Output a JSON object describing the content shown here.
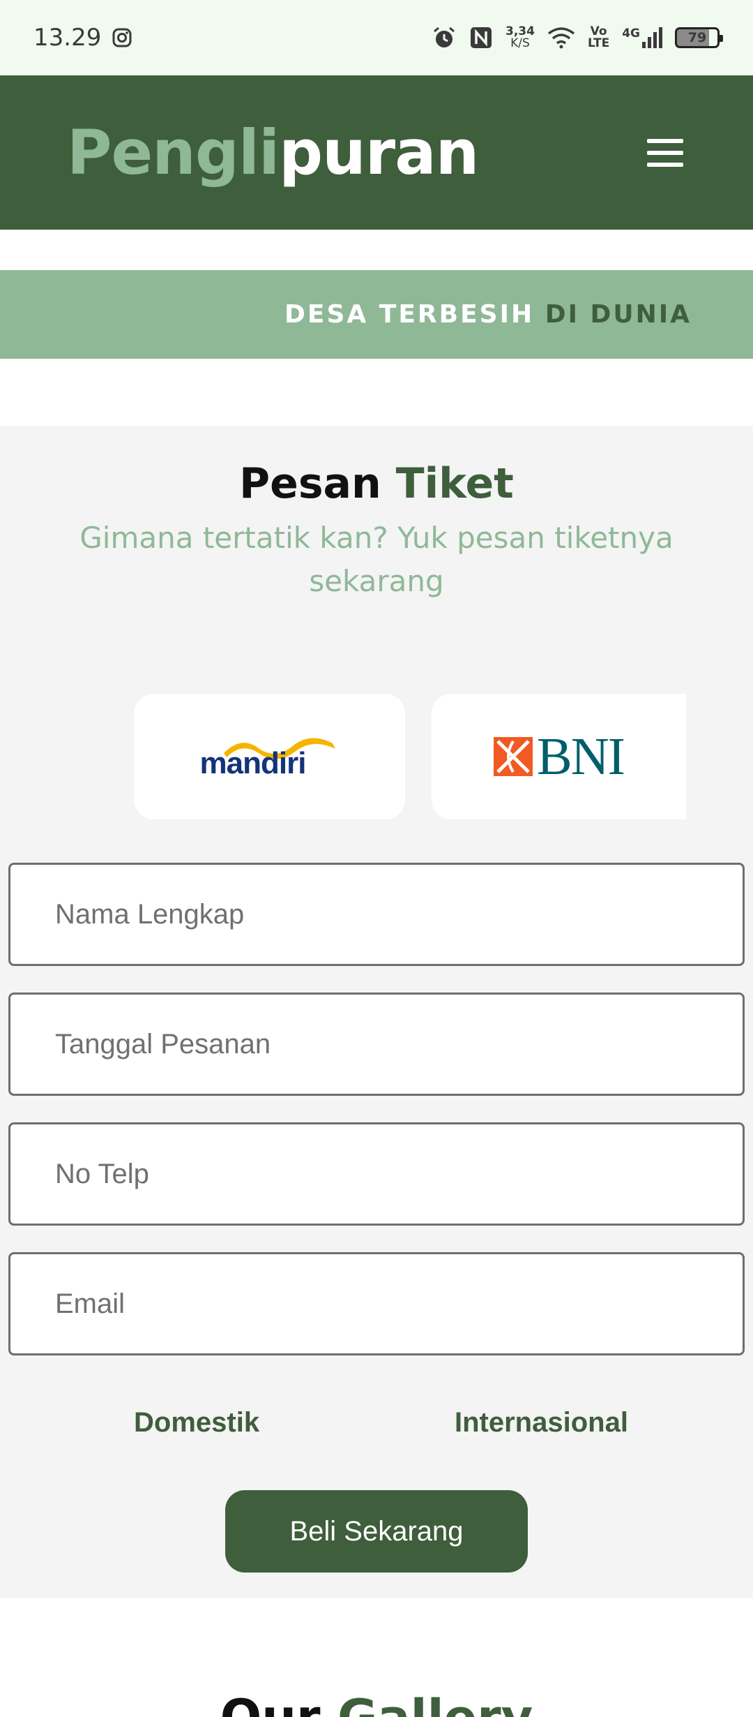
{
  "status_bar": {
    "time": "13.29",
    "net_speed_value": "3,34",
    "net_speed_unit": "K/S",
    "volte_top": "Vo",
    "volte_bottom": "LTE",
    "network": "4G",
    "battery": "79"
  },
  "header": {
    "logo_part1": "Pengli",
    "logo_part2": "puran"
  },
  "banner": {
    "text_white": "DESA TERBESIH",
    "text_green": "DI DUNIA"
  },
  "ticket": {
    "title_part1": "Pesan",
    "title_part2": "Tiket",
    "subtitle": "Gimana tertatik kan? Yuk pesan tiketnya sekarang",
    "banks": [
      {
        "name": "mandiri"
      },
      {
        "name": "BNI"
      }
    ],
    "fields": {
      "name_placeholder": "Nama Lengkap",
      "date_placeholder": "Tanggal Pesanan",
      "phone_placeholder": "No Telp",
      "email_placeholder": "Email"
    },
    "options": {
      "domestic": "Domestik",
      "international": "Internasional"
    },
    "buy_button": "Beli Sekarang"
  },
  "gallery": {
    "title_part1": "Our",
    "title_part2": "Gallery"
  },
  "colors": {
    "primary": "#3f5e3c",
    "accent": "#8fb897",
    "section_bg": "#f4f4f4"
  }
}
